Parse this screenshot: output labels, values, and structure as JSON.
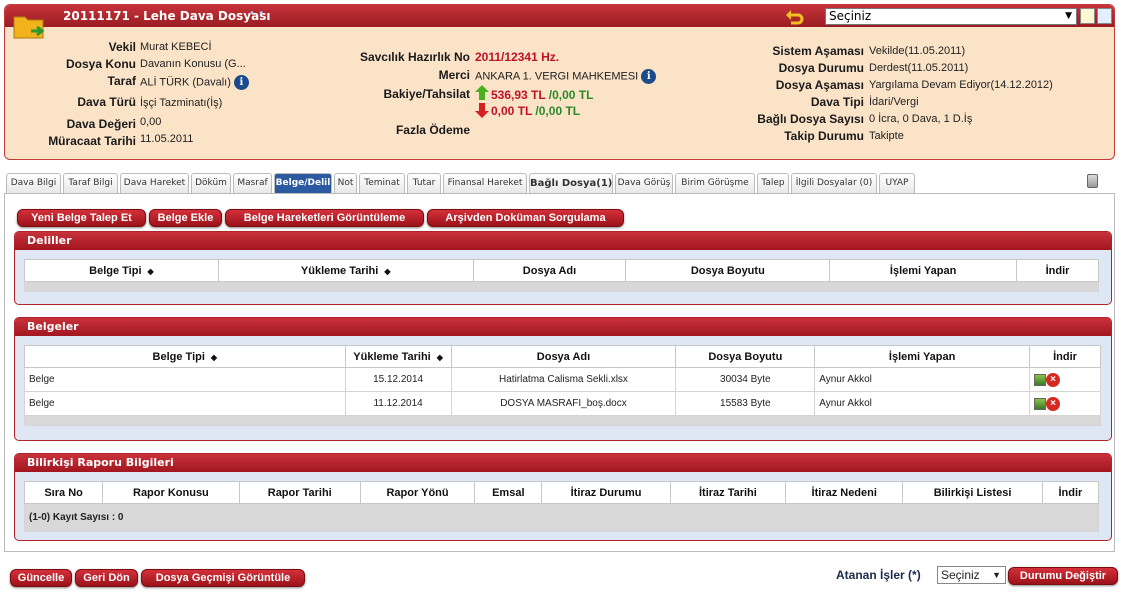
{
  "header": {
    "title": "20111171 - Lehe Dava Dosyası",
    "dots": "• •",
    "select_value": "Seçiniz"
  },
  "left": {
    "vekil_label": "Vekil",
    "vekil": "Murat KEBECİ",
    "konu_label": "Dosya Konu",
    "konu": "Davanın Konusu (G...",
    "taraf_label": "Taraf",
    "taraf": "ALİ TÜRK  (Davalı)",
    "turu_label": "Dava Türü",
    "turu": "İşçi Tazminatı(İş)",
    "deger_label": "Dava Değeri",
    "deger": "0,00",
    "muracaat_label": "Müracaat Tarihi",
    "muracaat": "11.05.2011"
  },
  "mid": {
    "savcilik_label": "Savcılık Hazırlık No",
    "savcilik": "2011/12341 Hz.",
    "merci_label": "Merci",
    "merci": "ANKARA 1. VERGI MAHKEMESI",
    "bakiye_label": "Bakiye/Tahsilat",
    "bakiye1": "536,93 TL",
    "tahsilat1": "/0,00 TL",
    "bakiye2": "0,00 TL",
    "tahsilat2": "/0,00 TL",
    "fazla_label": "Fazla Ödeme"
  },
  "right": {
    "sistem_label": "Sistem Aşaması",
    "sistem": "Vekilde(11.05.2011)",
    "durum_label": "Dosya Durumu",
    "durum": "Derdest(11.05.2011)",
    "asama_label": "Dosya Aşaması",
    "asama": "Yargılama Devam Ediyor(14.12.2012)",
    "tipi_label": "Dava Tipi",
    "tipi": "İdari/Vergi",
    "bagli_label": "Bağlı Dosya Sayısı",
    "bagli": "0 İcra, 0 Dava, 1 D.İş",
    "takip_label": "Takip Durumu",
    "takip": "Takipte"
  },
  "tabs": [
    "Dava Bilgi",
    "Taraf Bilgi",
    "Dava Hareket",
    "Döküm",
    "Masraf",
    "Belge/Delil",
    "Not",
    "Teminat",
    "Tutar",
    "Finansal Hareket",
    "Bağlı Dosya(1)",
    "Dava Görüş",
    "Birim Görüşme",
    "Talep",
    "İlgili Dosyalar (0)",
    "UYAP"
  ],
  "actions": [
    "Yeni Belge Talep Et",
    "Belge Ekle",
    "Belge Hareketleri Görüntüleme",
    "Arşivden Doküman Sorgulama"
  ],
  "deliller": {
    "title": "Deliller",
    "columns": [
      "Belge Tipi",
      "Yükleme Tarihi",
      "Dosya Adı",
      "Dosya Boyutu",
      "İşlemi Yapan",
      "İndir"
    ]
  },
  "belgeler": {
    "title": "Belgeler",
    "columns": [
      "Belge Tipi",
      "Yükleme Tarihi",
      "Dosya Adı",
      "Dosya Boyutu",
      "İşlemi Yapan",
      "İndir"
    ],
    "rows": [
      [
        "Belge",
        "15.12.2014",
        "Hatirlatma Calisma Sekli.xlsx",
        "30034 Byte",
        "Aynur Akkol"
      ],
      [
        "Belge",
        "11.12.2014",
        "DOSYA MASRAFI_boş.docx",
        "15583 Byte",
        "Aynur Akkol"
      ]
    ]
  },
  "bilirkisi": {
    "title": "Bilirkişi Raporu Bilgileri",
    "columns": [
      "Sıra No",
      "Rapor Konusu",
      "Rapor Tarihi",
      "Rapor Yönü",
      "Emsal",
      "İtiraz Durumu",
      "İtiraz Tarihi",
      "İtiraz Nedeni",
      "Bilirkişi Listesi",
      "İndir"
    ],
    "count": "(1-0) Kayıt Sayısı : 0"
  },
  "bottom": {
    "buttons": [
      "Güncelle",
      "Geri Dön",
      "Dosya Geçmişi Görüntüle"
    ],
    "atanan_label": "Atanan İşler (*)",
    "atanan_value": "Seçiniz",
    "durum_button": "Durumu Değiştir"
  }
}
